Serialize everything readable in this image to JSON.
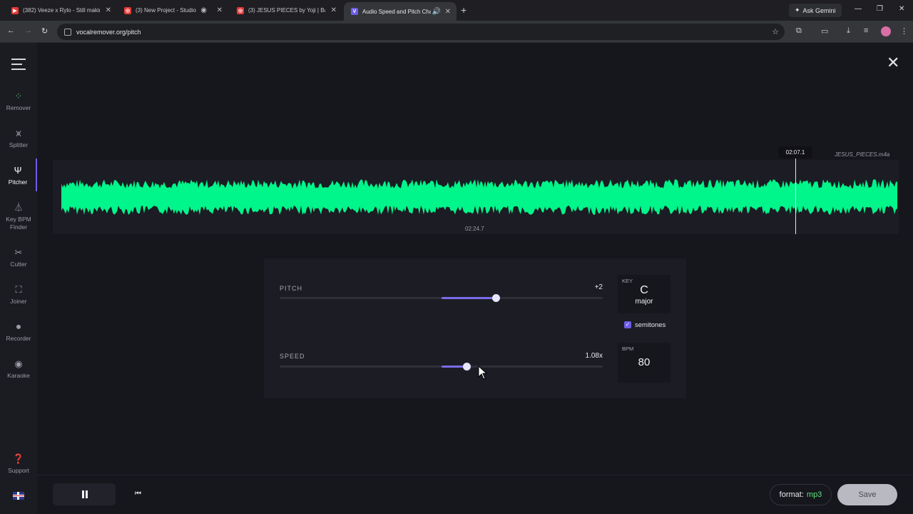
{
  "browser": {
    "tabs": [
      {
        "title": "(382) Veeze x Rylo - Still makin…",
        "favicon_color": "#e53935",
        "favicon_glyph": "▶"
      },
      {
        "title": "(3) New Project - Studio",
        "favicon_color": "#e53935",
        "favicon_glyph": "◎"
      },
      {
        "title": "(3) JESUS PIECES by Yoji | Band…",
        "favicon_color": "#e53935",
        "favicon_glyph": "◎"
      },
      {
        "title": "Audio Speed and Pitch Cha…",
        "favicon_color": "#6c5ce7",
        "favicon_glyph": "V"
      }
    ],
    "new_tab": "+",
    "gemini_label": "Ask Gemini",
    "url": "vocalremover.org/pitch",
    "window_controls": [
      "—",
      "❐",
      "✕"
    ]
  },
  "sidebar": {
    "items": [
      {
        "label": "Remover",
        "icon": "remover-icon",
        "glyph": "⁘"
      },
      {
        "label": "Splitter",
        "icon": "splitter-icon",
        "glyph": "⩙"
      },
      {
        "label": "Pitcher",
        "icon": "tuning-fork-icon",
        "glyph": "Ψ"
      },
      {
        "label": "Key BPM Finder",
        "icon": "metronome-icon",
        "glyph": "⏃"
      },
      {
        "label": "Cutter",
        "icon": "scissors-icon",
        "glyph": "✂"
      },
      {
        "label": "Joiner",
        "icon": "joiner-icon",
        "glyph": "⛶"
      },
      {
        "label": "Recorder",
        "icon": "microphone-icon",
        "glyph": "🎙"
      },
      {
        "label": "Karaoke",
        "icon": "karaoke-icon",
        "glyph": "◉"
      }
    ],
    "active": "Pitcher",
    "support_label": "Support",
    "language": "English (UK)"
  },
  "player": {
    "filename": "JESUS_PIECES.m4a",
    "current_time": "02:07.1",
    "duration": "02:24.7",
    "wave_color": "#00f58a",
    "accent": "#6c5ce7"
  },
  "controls": {
    "pitch_label": "PITCH",
    "pitch_value": "+2",
    "pitch_level": 0.67,
    "speed_label": "SPEED",
    "speed_value": "1.08x",
    "speed_level": 0.58,
    "key_caption": "KEY",
    "key_note": "C",
    "key_mode": "major",
    "semitones_label": "semitones",
    "semitones_checked": true,
    "bpm_caption": "BPM",
    "bpm_value": "80"
  },
  "bottom": {
    "format_label": "format:",
    "format_value": "mp3",
    "save_label": "Save"
  }
}
